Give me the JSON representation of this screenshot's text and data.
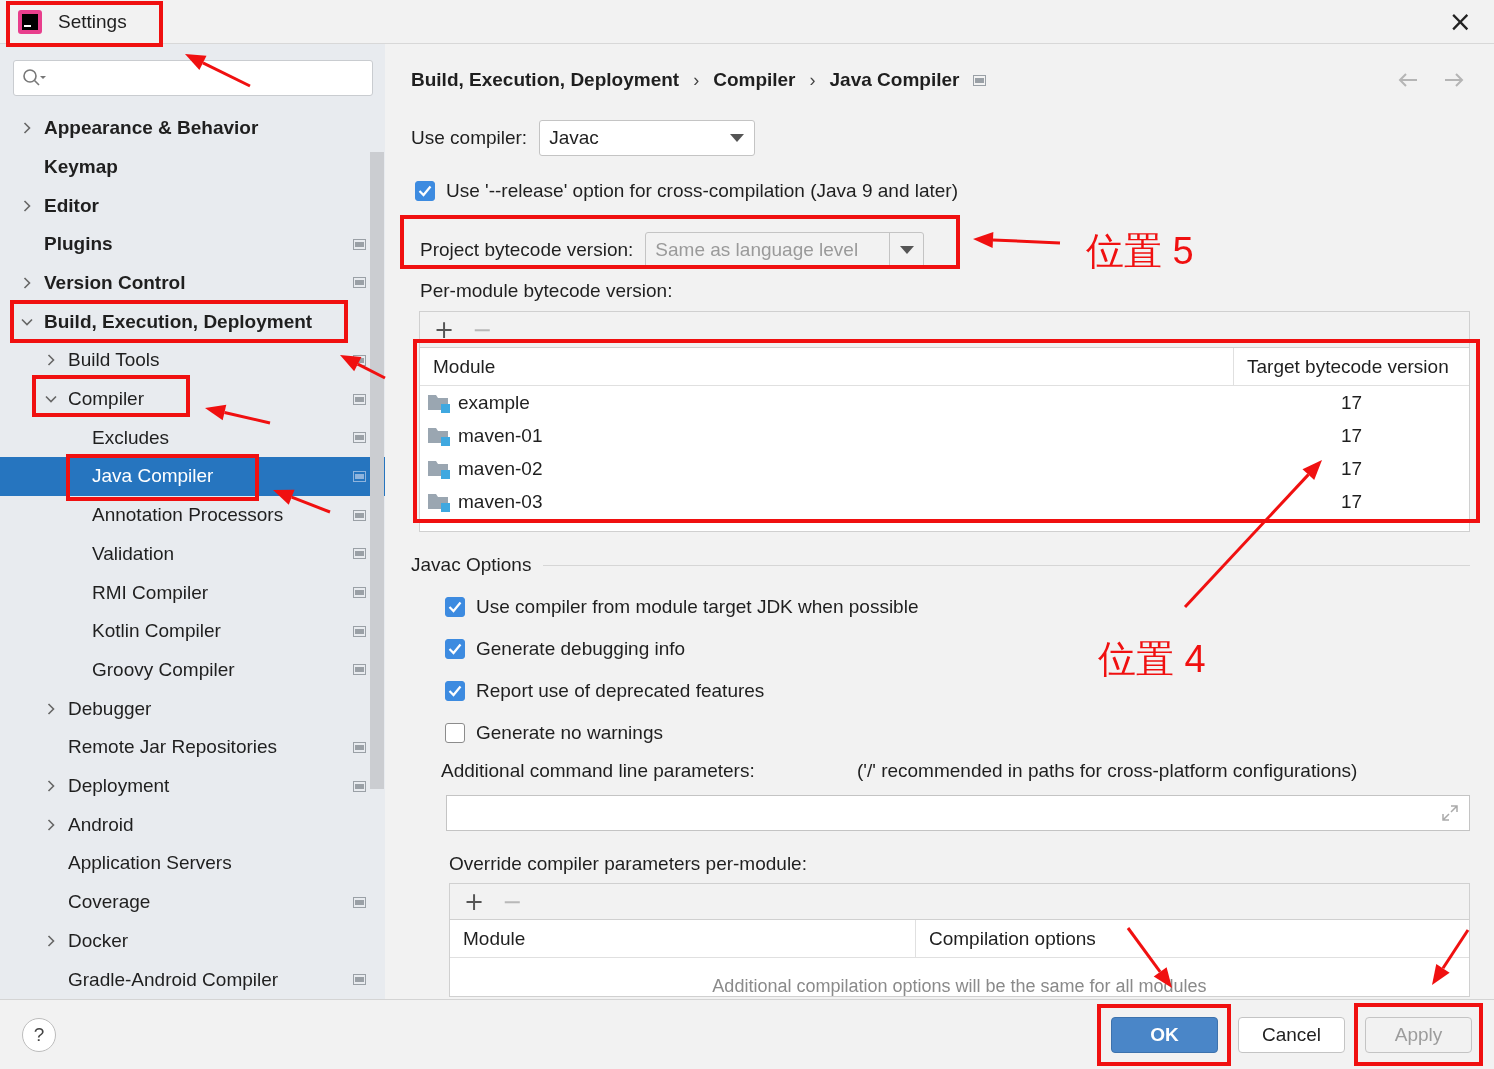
{
  "window": {
    "title": "Settings",
    "close": "×"
  },
  "sidebar": {
    "tree": [
      {
        "label": "Appearance & Behavior",
        "expanded": false,
        "project_level": false,
        "selected": false
      },
      {
        "label": "Keymap",
        "project_level": false,
        "selected": false
      },
      {
        "label": "Editor",
        "expanded": false,
        "project_level": false,
        "selected": false
      },
      {
        "label": "Plugins",
        "project_level": true,
        "selected": false
      },
      {
        "label": "Version Control",
        "expanded": false,
        "project_level": true,
        "selected": false
      },
      {
        "label": "Build, Execution, Deployment",
        "expanded": true,
        "project_level": false,
        "selected": false,
        "children": [
          {
            "label": "Build Tools",
            "expanded": false,
            "project_level": true,
            "selected": false
          },
          {
            "label": "Compiler",
            "expanded": true,
            "project_level": true,
            "selected": false,
            "children": [
              {
                "label": "Excludes",
                "project_level": true,
                "selected": false
              },
              {
                "label": "Java Compiler",
                "project_level": true,
                "selected": true
              },
              {
                "label": "Annotation Processors",
                "project_level": true,
                "selected": false
              },
              {
                "label": "Validation",
                "project_level": true,
                "selected": false
              },
              {
                "label": "RMI Compiler",
                "project_level": true,
                "selected": false
              },
              {
                "label": "Kotlin Compiler",
                "project_level": true,
                "selected": false
              },
              {
                "label": "Groovy Compiler",
                "project_level": true,
                "selected": false
              }
            ]
          },
          {
            "label": "Debugger",
            "expanded": false,
            "project_level": false,
            "selected": false
          },
          {
            "label": "Remote Jar Repositories",
            "project_level": true,
            "selected": false
          },
          {
            "label": "Deployment",
            "expanded": false,
            "project_level": true,
            "selected": false
          },
          {
            "label": "Android",
            "expanded": false,
            "project_level": false,
            "selected": false
          },
          {
            "label": "Application Servers",
            "project_level": false,
            "selected": false
          },
          {
            "label": "Coverage",
            "project_level": true,
            "selected": false
          },
          {
            "label": "Docker",
            "expanded": false,
            "project_level": false,
            "selected": false
          },
          {
            "label": "Gradle-Android Compiler",
            "project_level": true,
            "selected": false
          }
        ]
      }
    ]
  },
  "breadcrumb": [
    "Build, Execution, Deployment",
    "Compiler",
    "Java Compiler"
  ],
  "breadcrumb_separator": "›",
  "nav": {
    "back_disabled": true,
    "forward_disabled": true
  },
  "use_compiler": {
    "label": "Use compiler:",
    "value": "Javac"
  },
  "release_option": {
    "label": "Use '--release' option for cross-compilation (Java 9 and later)",
    "checked": true
  },
  "project_bytecode": {
    "label": "Project bytecode version:",
    "placeholder": "Same as language level"
  },
  "per_module": {
    "label": "Per-module bytecode version:",
    "add": "+",
    "remove": "−",
    "remove_disabled": true,
    "columns": [
      "Module",
      "Target bytecode version"
    ],
    "rows": [
      {
        "module": "example",
        "version": "17"
      },
      {
        "module": "maven-01",
        "version": "17"
      },
      {
        "module": "maven-02",
        "version": "17"
      },
      {
        "module": "maven-03",
        "version": "17"
      }
    ]
  },
  "javac_options": {
    "title": "Javac Options",
    "options": [
      {
        "label": "Use compiler from module target JDK when possible",
        "checked": true
      },
      {
        "label": "Generate debugging info",
        "checked": true
      },
      {
        "label": "Report use of deprecated features",
        "checked": true
      },
      {
        "label": "Generate no warnings",
        "checked": false
      }
    ],
    "params_label": "Additional command line parameters:",
    "params_hint": "('/' recommended in paths for cross-platform configurations)"
  },
  "override": {
    "label": "Override compiler parameters per-module:",
    "add": "+",
    "remove": "−",
    "remove_disabled": true,
    "columns": [
      "Module",
      "Compilation options"
    ],
    "empty_text": "Additional compilation options will be the same for all modules"
  },
  "buttons": [
    {
      "label": "OK",
      "kind": "default",
      "disabled": false
    },
    {
      "label": "Cancel",
      "kind": "normal",
      "disabled": false
    },
    {
      "label": "Apply",
      "kind": "normal",
      "disabled": true
    }
  ],
  "help": "?",
  "annotations": [
    "位置 5",
    "位置 4"
  ]
}
